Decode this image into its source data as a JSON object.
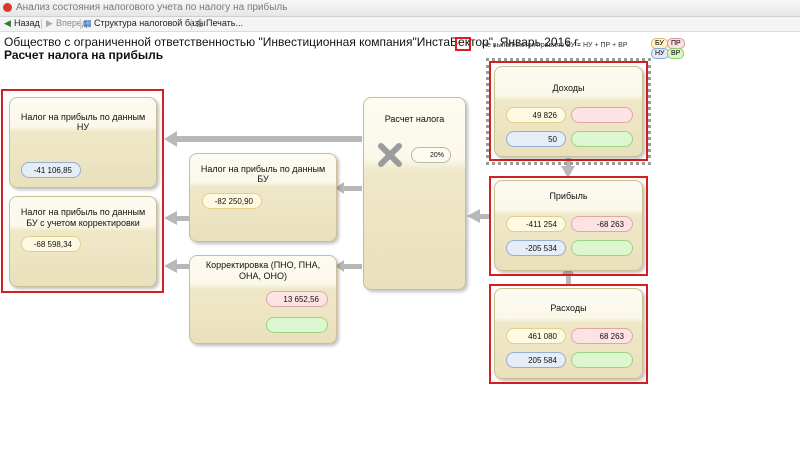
{
  "window": {
    "title": "Анализ состояния налогового учета по налогу на прибыль"
  },
  "toolbar": {
    "back_label": "Назад",
    "forward_label": "Вперед",
    "structure_label": "Структура налоговой базы",
    "print_label": "Печать..."
  },
  "header": {
    "org_text": "Общество с ограниченной ответственностью \"Инвестиционная компания\"ИнстаВектор\", Январь 2016 г.",
    "page_title": "Расчет налога на прибыль",
    "rule_text": "Не выполняется правило БУ = НУ + ПР + ВР",
    "badges": {
      "bu": "БУ",
      "pr": "ПР",
      "nu": "НУ",
      "vr": "ВР"
    }
  },
  "cards": {
    "income": {
      "title": "Доходы",
      "bu_value": "49 826",
      "pr_value": "",
      "nu_value": "50",
      "vr_value": ""
    },
    "profit": {
      "title": "Прибыль",
      "bu_value": "-411 254",
      "pr_value": "-68 263",
      "nu_value": "-205 534",
      "vr_value": ""
    },
    "expenses": {
      "title": "Расходы",
      "bu_value": "461 080",
      "pr_value": "68 263",
      "nu_value": "205 584",
      "vr_value": ""
    },
    "tax_calc": {
      "title": "Расчет налога",
      "rate": "20%"
    },
    "tax_bu": {
      "title": "Налог на прибыль по данным БУ",
      "value": "-82 250,90"
    },
    "correction": {
      "title": "Корректировка (ПНО, ПНА, ОНА, ОНО)",
      "pr_value": "13 652,56",
      "vr_value": ""
    },
    "tax_nu": {
      "title": "Налог на прибыль по данным НУ",
      "value": "-41 106,85"
    },
    "tax_bu_corr": {
      "title": "Налог на прибыль по данным БУ с учетом корректировки",
      "value": "-68 598,34"
    }
  },
  "colors": {
    "highlight_red": "#d42020",
    "arrow_gray": "#b8b8b8",
    "card_beige": "#ece4c2"
  }
}
